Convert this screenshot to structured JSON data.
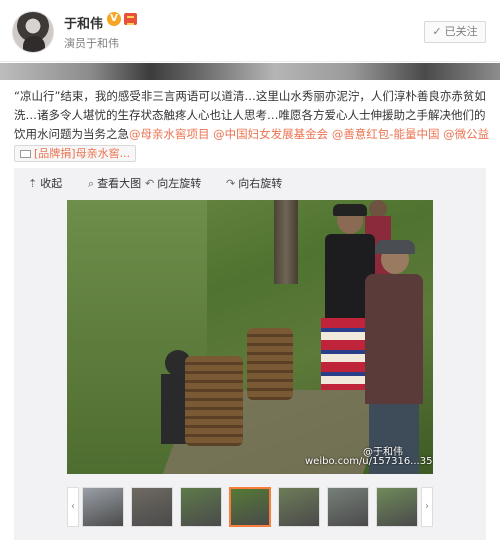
{
  "header": {
    "name": "于和伟",
    "verified_mark": "V",
    "description": "演员于和伟",
    "follow_label": "已关注",
    "follow_check": "✓"
  },
  "post": {
    "text": "“凉山行”结束，我的感受非三言两语可以道清…这里山水秀丽亦泥泞，人们淳朴善良亦赤贫如洗…诸多令人堪忧的生存状态触疼人心也让人思考…唯愿各方爱心人士伸援助之手解决他们的饮用水问题为当务之急",
    "links": [
      "@母亲水窖项目",
      "@中国妇女发展基金会",
      "@善意红包-能量中国",
      "@微公益"
    ],
    "brand_link": "[品牌捐]母亲水窖..."
  },
  "toolbar": {
    "collapse": "收起",
    "view_large": "查看大图",
    "rotate_left": "向左旋转",
    "rotate_right": "向右旋转"
  },
  "photo": {
    "watermark_name": "@于和伟",
    "watermark_url": "weibo.com/u/157316...35"
  },
  "thumbnails": {
    "count": 7,
    "active_index": 3,
    "colors": [
      "#9aa0a8",
      "#6f6a62",
      "#5e7a4a",
      "#557a35",
      "#6d7c58",
      "#77807a",
      "#6f8a5a"
    ]
  },
  "colors": {
    "link": "#eb7350",
    "active_thumb_border": "#fa7d3c",
    "verified_badge": "#f6a623"
  }
}
